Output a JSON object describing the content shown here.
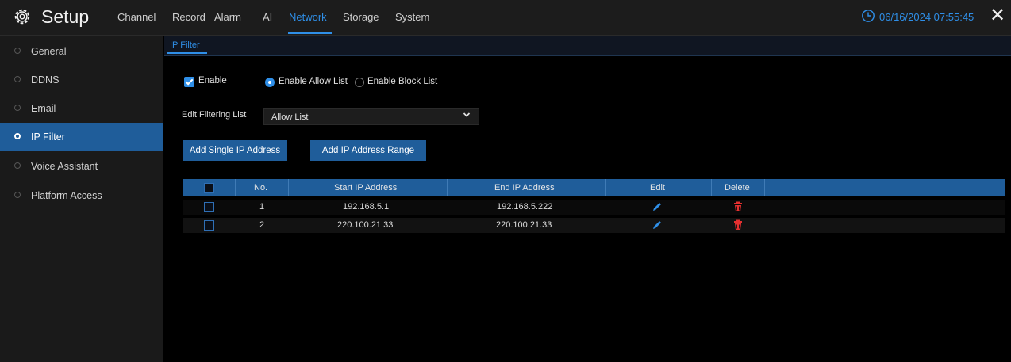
{
  "header": {
    "title": "Setup",
    "menu": [
      {
        "label": "Channel"
      },
      {
        "label": "Record"
      },
      {
        "label": "Alarm"
      },
      {
        "label": "AI"
      },
      {
        "label": "Network",
        "active": true
      },
      {
        "label": "Storage"
      },
      {
        "label": "System"
      }
    ],
    "datetime": "06/16/2024 07:55:45",
    "close_label": "✕"
  },
  "sidebar": {
    "items": [
      {
        "label": "General"
      },
      {
        "label": "DDNS"
      },
      {
        "label": "Email"
      },
      {
        "label": "IP Filter",
        "active": true
      },
      {
        "label": "Voice Assistant"
      },
      {
        "label": "Platform Access"
      }
    ]
  },
  "tabs": [
    {
      "label": "IP Filter"
    }
  ],
  "filter": {
    "enable_label": "Enable",
    "enable_checked": true,
    "allow_label": "Enable Allow List",
    "block_label": "Enable Block List",
    "mode_selected": "allow",
    "edit_list_label": "Edit Filtering List",
    "edit_list_value": "Allow List",
    "add_single_label": "Add Single IP Address",
    "add_range_label": "Add IP Address Range"
  },
  "table": {
    "columns": [
      "No.",
      "Start IP Address",
      "End IP Address",
      "Edit",
      "Delete"
    ],
    "rows": [
      {
        "no": "1",
        "start": "192.168.5.1",
        "end": "192.168.5.222"
      },
      {
        "no": "2",
        "start": "220.100.21.33",
        "end": "220.100.21.33"
      }
    ]
  },
  "colors": {
    "accent": "#2f8fe8",
    "highlight": "#1f5d9a",
    "delete": "#e53030"
  },
  "icons": {
    "title": "gear-icon",
    "clock": "clock-icon",
    "edit": "pencil-icon",
    "delete": "trash-icon",
    "dropdown": "chevron-down-icon"
  }
}
